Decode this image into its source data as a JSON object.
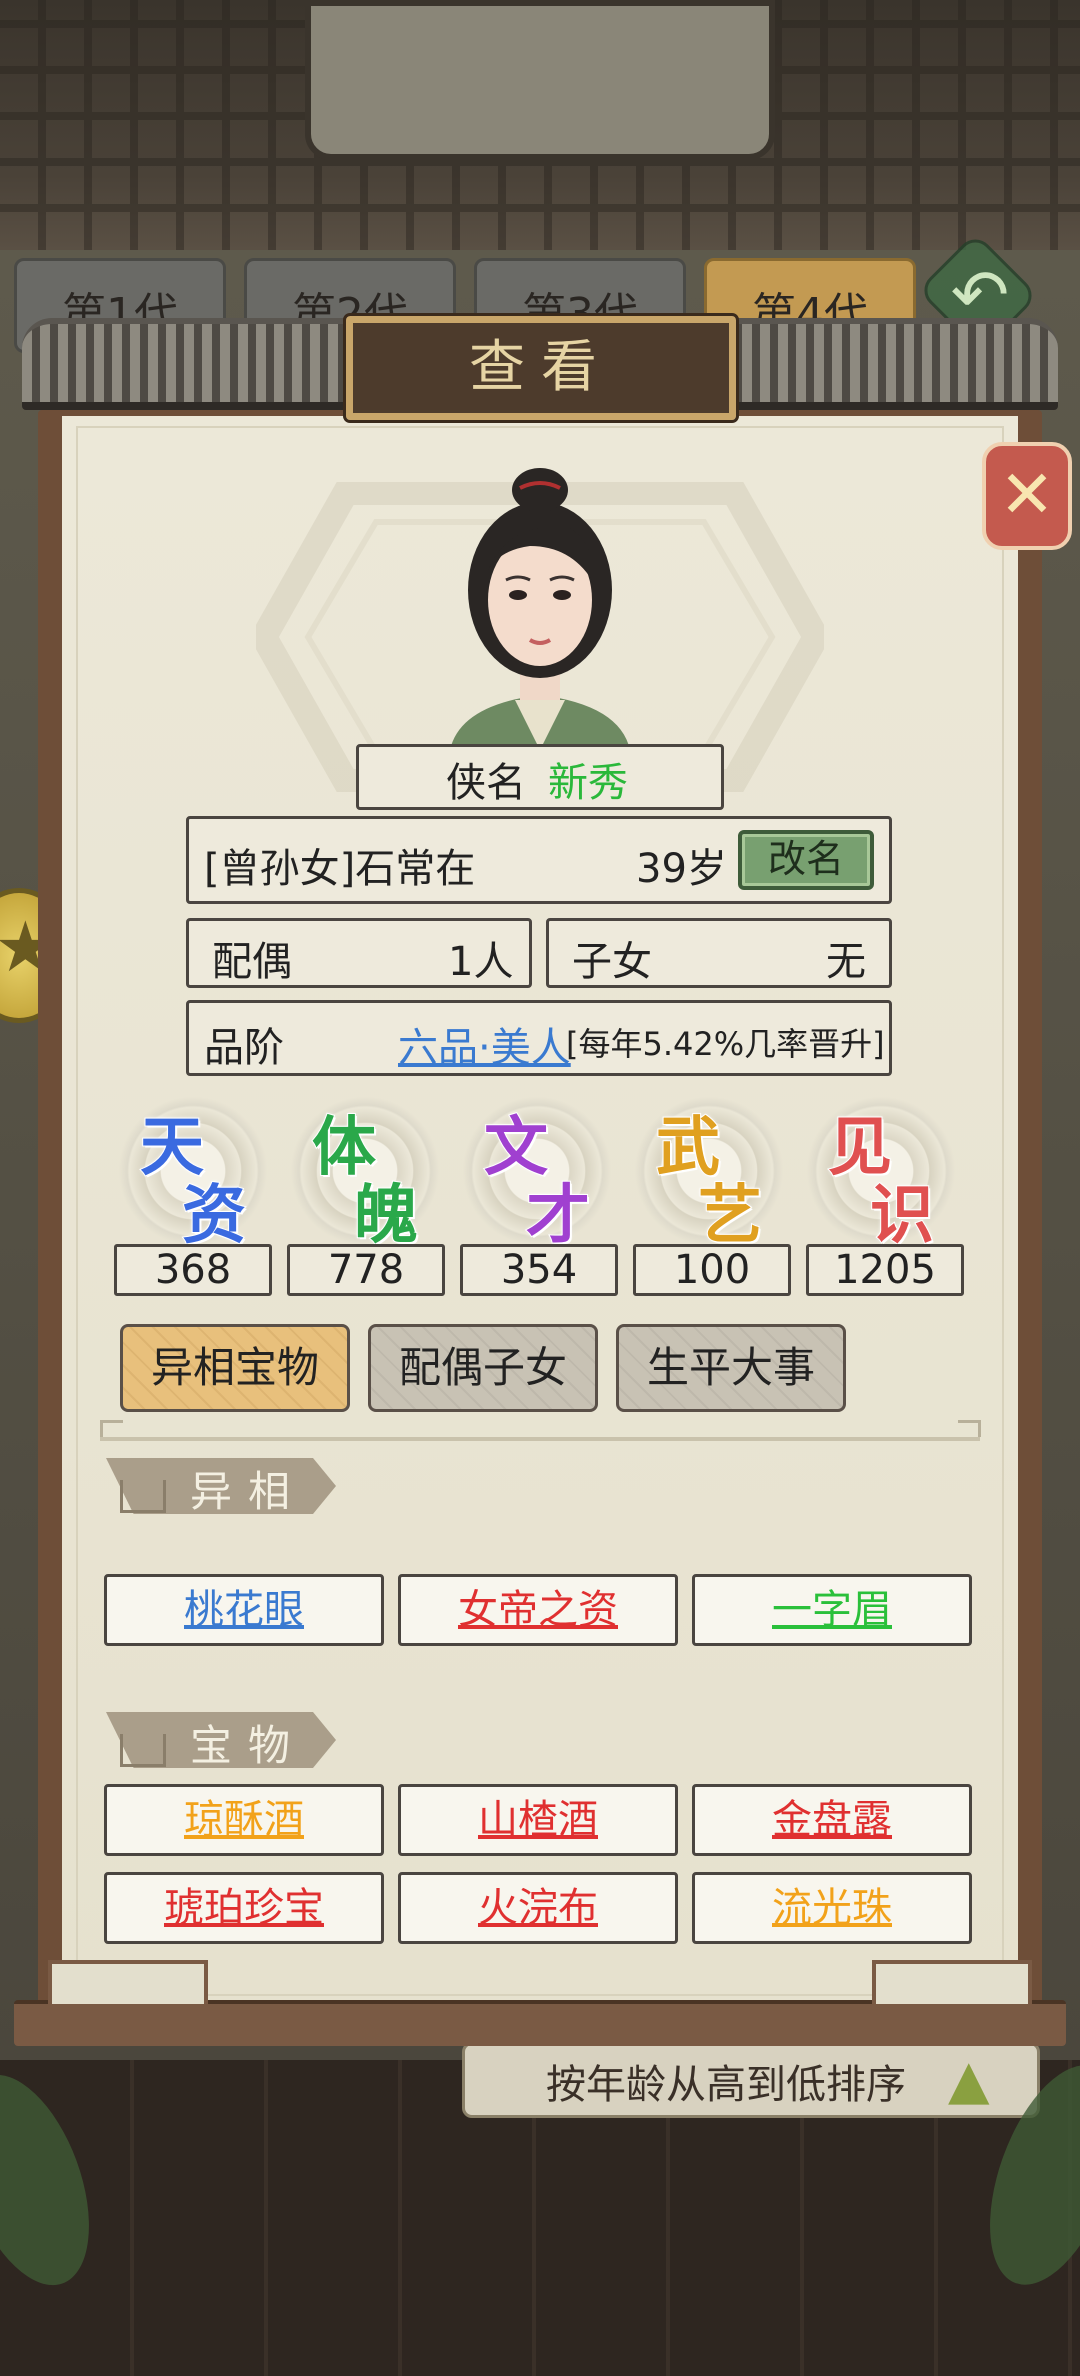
{
  "generation_tabs": [
    "第1代",
    "第2代",
    "第3代",
    "第4代"
  ],
  "active_generation": 3,
  "sort_label": "按年龄从高到低排序",
  "dialog": {
    "title": "查看",
    "hero_name_label": "侠名",
    "hero_name_value": "新秀",
    "character_name": "[曾孙女]石常在",
    "age": "39岁",
    "rename_label": "改名",
    "spouse_label": "配偶",
    "spouse_value": "1人",
    "children_label": "子女",
    "children_value": "无",
    "rank_label": "品阶",
    "rank_value": "六品·美人",
    "rank_note": "[每年5.42%几率晋升]"
  },
  "stats": [
    {
      "chars": [
        "天",
        "资"
      ],
      "value": "368",
      "color": "#3a6ae0"
    },
    {
      "chars": [
        "体",
        "魄"
      ],
      "value": "778",
      "color": "#2aa84a"
    },
    {
      "chars": [
        "文",
        "才"
      ],
      "value": "354",
      "color": "#a040d0"
    },
    {
      "chars": [
        "武",
        "艺"
      ],
      "value": "100",
      "color": "#e0a020"
    },
    {
      "chars": [
        "见",
        "识"
      ],
      "value": "1205",
      "color": "#e05050"
    }
  ],
  "tabs": [
    {
      "label": "异相宝物",
      "active": true
    },
    {
      "label": "配偶子女",
      "active": false
    },
    {
      "label": "生平大事",
      "active": false
    }
  ],
  "traits_section": "异相",
  "traits": [
    {
      "label": "桃花眼",
      "color": "blue"
    },
    {
      "label": "女帝之资",
      "color": "red"
    },
    {
      "label": "一字眉",
      "color": "green"
    }
  ],
  "treasures_section": "宝物",
  "treasures": [
    {
      "label": "琼酥酒",
      "color": "orange"
    },
    {
      "label": "山楂酒",
      "color": "red"
    },
    {
      "label": "金盘露",
      "color": "red"
    },
    {
      "label": "琥珀珍宝",
      "color": "red"
    },
    {
      "label": "火浣布",
      "color": "red"
    },
    {
      "label": "流光珠",
      "color": "orange"
    }
  ]
}
